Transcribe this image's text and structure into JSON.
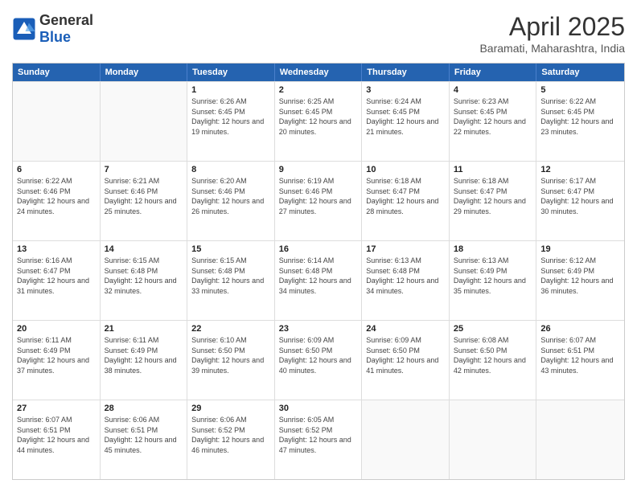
{
  "header": {
    "logo_general": "General",
    "logo_blue": "Blue",
    "month_title": "April 2025",
    "subtitle": "Baramati, Maharashtra, India"
  },
  "calendar": {
    "days": [
      "Sunday",
      "Monday",
      "Tuesday",
      "Wednesday",
      "Thursday",
      "Friday",
      "Saturday"
    ],
    "rows": [
      [
        {
          "day": "",
          "info": ""
        },
        {
          "day": "",
          "info": ""
        },
        {
          "day": "1",
          "info": "Sunrise: 6:26 AM\nSunset: 6:45 PM\nDaylight: 12 hours and 19 minutes."
        },
        {
          "day": "2",
          "info": "Sunrise: 6:25 AM\nSunset: 6:45 PM\nDaylight: 12 hours and 20 minutes."
        },
        {
          "day": "3",
          "info": "Sunrise: 6:24 AM\nSunset: 6:45 PM\nDaylight: 12 hours and 21 minutes."
        },
        {
          "day": "4",
          "info": "Sunrise: 6:23 AM\nSunset: 6:45 PM\nDaylight: 12 hours and 22 minutes."
        },
        {
          "day": "5",
          "info": "Sunrise: 6:22 AM\nSunset: 6:45 PM\nDaylight: 12 hours and 23 minutes."
        }
      ],
      [
        {
          "day": "6",
          "info": "Sunrise: 6:22 AM\nSunset: 6:46 PM\nDaylight: 12 hours and 24 minutes."
        },
        {
          "day": "7",
          "info": "Sunrise: 6:21 AM\nSunset: 6:46 PM\nDaylight: 12 hours and 25 minutes."
        },
        {
          "day": "8",
          "info": "Sunrise: 6:20 AM\nSunset: 6:46 PM\nDaylight: 12 hours and 26 minutes."
        },
        {
          "day": "9",
          "info": "Sunrise: 6:19 AM\nSunset: 6:46 PM\nDaylight: 12 hours and 27 minutes."
        },
        {
          "day": "10",
          "info": "Sunrise: 6:18 AM\nSunset: 6:47 PM\nDaylight: 12 hours and 28 minutes."
        },
        {
          "day": "11",
          "info": "Sunrise: 6:18 AM\nSunset: 6:47 PM\nDaylight: 12 hours and 29 minutes."
        },
        {
          "day": "12",
          "info": "Sunrise: 6:17 AM\nSunset: 6:47 PM\nDaylight: 12 hours and 30 minutes."
        }
      ],
      [
        {
          "day": "13",
          "info": "Sunrise: 6:16 AM\nSunset: 6:47 PM\nDaylight: 12 hours and 31 minutes."
        },
        {
          "day": "14",
          "info": "Sunrise: 6:15 AM\nSunset: 6:48 PM\nDaylight: 12 hours and 32 minutes."
        },
        {
          "day": "15",
          "info": "Sunrise: 6:15 AM\nSunset: 6:48 PM\nDaylight: 12 hours and 33 minutes."
        },
        {
          "day": "16",
          "info": "Sunrise: 6:14 AM\nSunset: 6:48 PM\nDaylight: 12 hours and 34 minutes."
        },
        {
          "day": "17",
          "info": "Sunrise: 6:13 AM\nSunset: 6:48 PM\nDaylight: 12 hours and 34 minutes."
        },
        {
          "day": "18",
          "info": "Sunrise: 6:13 AM\nSunset: 6:49 PM\nDaylight: 12 hours and 35 minutes."
        },
        {
          "day": "19",
          "info": "Sunrise: 6:12 AM\nSunset: 6:49 PM\nDaylight: 12 hours and 36 minutes."
        }
      ],
      [
        {
          "day": "20",
          "info": "Sunrise: 6:11 AM\nSunset: 6:49 PM\nDaylight: 12 hours and 37 minutes."
        },
        {
          "day": "21",
          "info": "Sunrise: 6:11 AM\nSunset: 6:49 PM\nDaylight: 12 hours and 38 minutes."
        },
        {
          "day": "22",
          "info": "Sunrise: 6:10 AM\nSunset: 6:50 PM\nDaylight: 12 hours and 39 minutes."
        },
        {
          "day": "23",
          "info": "Sunrise: 6:09 AM\nSunset: 6:50 PM\nDaylight: 12 hours and 40 minutes."
        },
        {
          "day": "24",
          "info": "Sunrise: 6:09 AM\nSunset: 6:50 PM\nDaylight: 12 hours and 41 minutes."
        },
        {
          "day": "25",
          "info": "Sunrise: 6:08 AM\nSunset: 6:50 PM\nDaylight: 12 hours and 42 minutes."
        },
        {
          "day": "26",
          "info": "Sunrise: 6:07 AM\nSunset: 6:51 PM\nDaylight: 12 hours and 43 minutes."
        }
      ],
      [
        {
          "day": "27",
          "info": "Sunrise: 6:07 AM\nSunset: 6:51 PM\nDaylight: 12 hours and 44 minutes."
        },
        {
          "day": "28",
          "info": "Sunrise: 6:06 AM\nSunset: 6:51 PM\nDaylight: 12 hours and 45 minutes."
        },
        {
          "day": "29",
          "info": "Sunrise: 6:06 AM\nSunset: 6:52 PM\nDaylight: 12 hours and 46 minutes."
        },
        {
          "day": "30",
          "info": "Sunrise: 6:05 AM\nSunset: 6:52 PM\nDaylight: 12 hours and 47 minutes."
        },
        {
          "day": "",
          "info": ""
        },
        {
          "day": "",
          "info": ""
        },
        {
          "day": "",
          "info": ""
        }
      ]
    ]
  }
}
